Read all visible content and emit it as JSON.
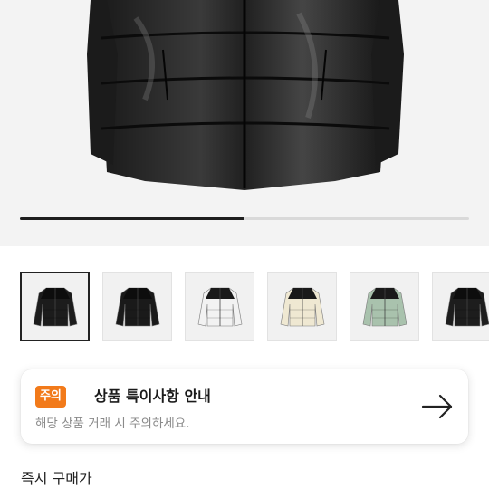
{
  "gallery": {
    "image_icon": "black-puffer-jacket-photo",
    "progress_fraction": 0.5,
    "thumbnail_count": 6,
    "thumbnail_colors": [
      "#1c1c1c",
      "#1a1a1a",
      "#f2f2f2",
      "#efe8d2",
      "#a9c2ad",
      "#1d1d1d"
    ],
    "selected_index": 0
  },
  "notice": {
    "badge": "주의",
    "title": "상품 특이사항 안내",
    "subtitle": "해당 상품 거래 시 주의하세요.",
    "arrow_icon": "arrow-right-icon",
    "badge_color": "#f27a1a"
  },
  "section": {
    "instant_price_label": "즉시 구매가"
  }
}
